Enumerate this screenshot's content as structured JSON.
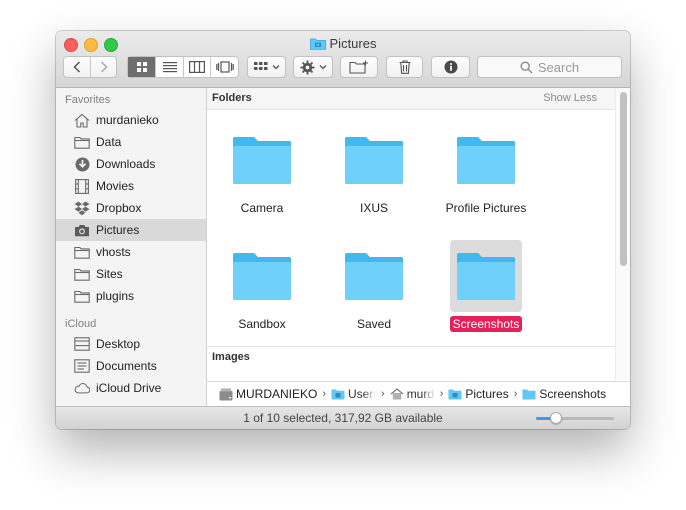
{
  "window": {
    "title": "Pictures"
  },
  "toolbar": {
    "back_icon": "chevron-left-icon",
    "forward_icon": "chevron-right-icon",
    "view_modes": [
      "icon-view",
      "list-view",
      "column-view",
      "cover-flow-view"
    ],
    "active_view": "icon-view",
    "arrange_icon": "arrange-icon",
    "action_icon": "gear-icon",
    "new_folder_icon": "new-folder-icon",
    "trash_icon": "trash-icon",
    "info_icon": "info-icon",
    "search_placeholder": "Search"
  },
  "sidebar": {
    "favorites_heading": "Favorites",
    "favorites": [
      {
        "label": "murdanieko",
        "icon": "home-icon"
      },
      {
        "label": "Data",
        "icon": "folder-icon"
      },
      {
        "label": "Downloads",
        "icon": "downloads-icon"
      },
      {
        "label": "Movies",
        "icon": "film-icon"
      },
      {
        "label": "Dropbox",
        "icon": "dropbox-icon"
      },
      {
        "label": "Pictures",
        "icon": "camera-icon",
        "selected": true
      },
      {
        "label": "vhosts",
        "icon": "folder-icon"
      },
      {
        "label": "Sites",
        "icon": "folder-icon"
      },
      {
        "label": "plugins",
        "icon": "folder-icon"
      }
    ],
    "icloud_heading": "iCloud",
    "icloud": [
      {
        "label": "Desktop",
        "icon": "desktop-icon"
      },
      {
        "label": "Documents",
        "icon": "documents-icon"
      },
      {
        "label": "iCloud Drive",
        "icon": "cloud-icon"
      }
    ]
  },
  "sections": {
    "folders_title": "Folders",
    "show_less": "Show Less",
    "images_title": "Images"
  },
  "folders": [
    {
      "name": "Camera",
      "selected": false
    },
    {
      "name": "IXUS",
      "selected": false
    },
    {
      "name": "Profile Pictures",
      "selected": false
    },
    {
      "name": "Sandbox",
      "selected": false
    },
    {
      "name": "Saved",
      "selected": false
    },
    {
      "name": "Screenshots",
      "selected": true
    }
  ],
  "path": [
    {
      "label": "MURDANIEKO",
      "icon": "drive-icon"
    },
    {
      "label": "Users",
      "icon": "folder-icon",
      "truncated": true
    },
    {
      "label": "murdanieko",
      "icon": "home-icon",
      "truncated": true
    },
    {
      "label": "Pictures",
      "icon": "folder-icon"
    },
    {
      "label": "Screenshots",
      "icon": "folder-icon"
    }
  ],
  "status": {
    "text": "1 of 10 selected, 317,92 GB available",
    "icon_size_fraction": 0.25
  },
  "colors": {
    "folder_blue": "#5fc8f7",
    "selection_pink": "#e5215a",
    "accent_blue": "#3b99fc"
  }
}
